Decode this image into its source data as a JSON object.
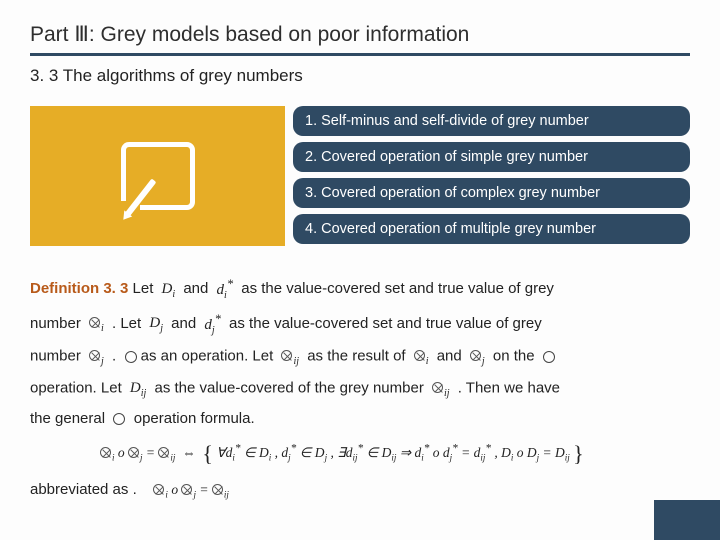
{
  "title": "Part Ⅲ: Grey models based on poor information",
  "subtitle": "3. 3 The algorithms of grey numbers",
  "bars": [
    "1. Self-minus and self-divide of grey number",
    "2. Covered operation of simple grey number",
    "3. Covered operation of complex grey number",
    "4. Covered operation of multiple grey number"
  ],
  "def": {
    "label": "Definition 3. 3",
    "t1": "Let",
    "t2": "and",
    "t3": "as the value-covered set and true value of grey",
    "t4": "number",
    "t5": ". Let",
    "t6": "and",
    "t7": "as the value-covered set and true value of grey",
    "t8": "number",
    "t9": ".",
    "t10": "as an operation. Let",
    "t11": "as the result of",
    "t12": "and",
    "t13": "on the",
    "t14": "operation. Let",
    "t15": "as the value-covered of the grey number",
    "t16": ". Then we have",
    "t17": "the general",
    "t18": "operation formula.",
    "abbrev": "abbreviated as ."
  },
  "math": {
    "Di": "D",
    "Di_sub": "i",
    "di": "d",
    "di_sub": "i",
    "di_sup": "*",
    "oi": "",
    "oi_sub": "i",
    "Dj": "D",
    "Dj_sub": "j",
    "dj": "d",
    "dj_sub": "j",
    "dj_sup": "*",
    "oj": "",
    "oj_sub": "j",
    "oij": "",
    "oij_sub": "ij",
    "Dij": "D",
    "Dij_sub": "ij"
  },
  "formula_text": "⊗ᵢ o ⊗ⱼ = ⊗ᵢⱼ ⇔ { ∀dᵢ* ∈ Dᵢ , dⱼ* ∈ Dⱼ , ∃dᵢⱼ* ∈ Dᵢⱼ ⇒ dᵢ* o dⱼ* = dᵢⱼ* , Dᵢ o Dⱼ = Dᵢⱼ }",
  "abbrev_formula": "⊗ᵢ o ⊗ⱼ = ⊗ᵢⱼ"
}
